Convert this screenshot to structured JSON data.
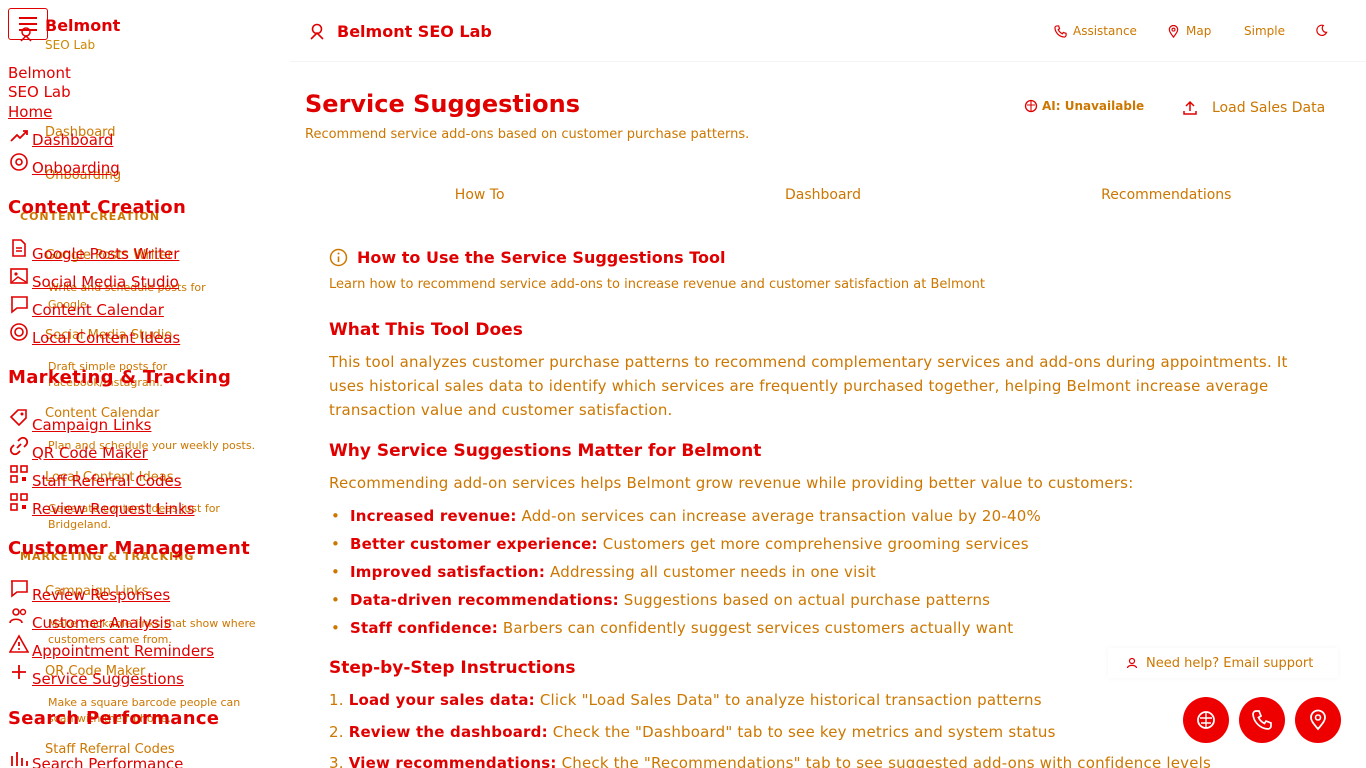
{
  "sidebar": {
    "brand_name": "Belmont",
    "brand_sub": "SEO Lab",
    "brand_full": "Belmont SEO Lab",
    "home_label": "Home",
    "links": {
      "dashboard": "Dashboard",
      "onboarding": "Onboarding",
      "google_posts": "Google Posts Writer",
      "social_media": "Social Media Studio",
      "content_calendar": "Content Calendar",
      "local_content": "Local Content Ideas",
      "campaign_links": "Campaign Links",
      "qr_code": "QR Code Maker",
      "staff_referral": "Staff Referral Codes",
      "review_request": "Review Request Links",
      "review_responses": "Review Responses",
      "customer_analysis": "Customer Analysis",
      "appointment_reminders": "Appointment Reminders",
      "service_suggestions": "Service Suggestions",
      "search_performance": "Search Performance"
    },
    "sections": {
      "content_creation": "Content Creation",
      "content_creation_caps": "CONTENT CREATION",
      "marketing": "Marketing & Tracking",
      "marketing_caps": "MARKETING & TRACKING",
      "customer": "Customer Management",
      "search": "Search Performance"
    },
    "ghosts": {
      "dashboard": "Dashboard",
      "onboarding": "Onboarding",
      "google_posts": "Google Posts Writer",
      "google_posts_desc_1": "Write and schedule posts for",
      "google_posts_desc_2": "Google.",
      "social_media": "Social Media Studio",
      "social_desc_1": "Draft simple posts for",
      "social_desc_2": "Facebook/Instagram.",
      "content_calendar": "Content Calendar",
      "calendar_desc": "Plan and schedule your weekly posts.",
      "local_content": "Local Content Ideas",
      "local_desc_1": "Generate content ideas just for",
      "local_desc_2": "Bridgeland.",
      "campaign_links": "Campaign Links",
      "campaign_desc_1": "Make trackable links that show where",
      "campaign_desc_2": "customers came from.",
      "qr_code": "QR Code Maker",
      "qr_desc_1": "Make a square barcode people can",
      "qr_desc_2": "scan with their phone.",
      "staff_referral": "Staff Referral Codes"
    }
  },
  "topbar": {
    "title": "Belmont SEO Lab",
    "assistance": "Assistance",
    "map": "Map",
    "simple": "Simple"
  },
  "header": {
    "title": "Service Suggestions",
    "description": "Recommend service add-ons based on customer purchase patterns.",
    "ai_status": "AI: Unavailable",
    "load_button": "Load Sales Data"
  },
  "tabs": [
    "How To",
    "Dashboard",
    "Recommendations"
  ],
  "howto": {
    "title": "How to Use the Service Suggestions Tool",
    "subtitle": "Learn how to recommend service add-ons to increase revenue and customer satisfaction at Belmont",
    "what_heading": "What This Tool Does",
    "what_body": "This tool analyzes customer purchase patterns to recommend complementary services and add-ons during appointments. It uses historical sales data to identify which services are frequently purchased together, helping Belmont increase average transaction value and customer satisfaction.",
    "why_heading": "Why Service Suggestions Matter for Belmont",
    "why_intro": "Recommending add-on services helps Belmont grow revenue while providing better value to customers:",
    "bullets": [
      {
        "bold": "Increased revenue:",
        "text": "Add-on services can increase average transaction value by 20-40%"
      },
      {
        "bold": "Better customer experience:",
        "text": "Customers get more comprehensive grooming services"
      },
      {
        "bold": "Improved satisfaction:",
        "text": "Addressing all customer needs in one visit"
      },
      {
        "bold": "Data-driven recommendations:",
        "text": "Suggestions based on actual purchase patterns"
      },
      {
        "bold": "Staff confidence:",
        "text": "Barbers can confidently suggest services customers actually want"
      }
    ],
    "steps_heading": "Step-by-Step Instructions",
    "steps": [
      {
        "num": "1.",
        "bold": "Load your sales data:",
        "text": "Click \"Load Sales Data\" to analyze historical transaction patterns"
      },
      {
        "num": "2.",
        "bold": "Review the dashboard:",
        "text": "Check the \"Dashboard\" tab to see key metrics and system status"
      },
      {
        "num": "3.",
        "bold": "View recommendations:",
        "text": "Check the \"Recommendations\" tab to see suggested add-ons with confidence levels"
      }
    ]
  },
  "help": {
    "label": "Need help? Email support"
  },
  "colors": {
    "primary": "#e00000",
    "secondary": "#cc7700",
    "fab": "#ee0000"
  }
}
